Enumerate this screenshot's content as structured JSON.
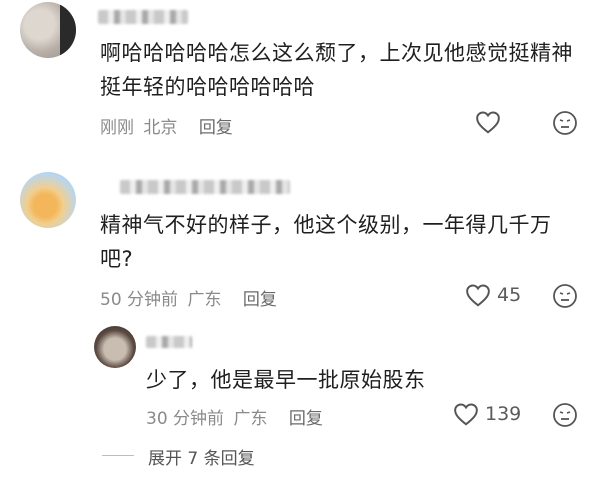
{
  "comments": [
    {
      "text_line1": "啊哈哈哈哈哈怎么这么颓了，上次见他感觉挺精神",
      "text_line2": "挺年轻的哈哈哈哈哈哈",
      "time": "刚刚",
      "location": "北京",
      "reply_label": "回复",
      "likes": ""
    },
    {
      "text_line1": "精神气不好的样子，他这个级别，一年得几千万",
      "text_line2": "吧?",
      "time": "50 分钟前",
      "location": "广东",
      "reply_label": "回复",
      "likes": "45"
    }
  ],
  "reply": {
    "text": "少了，他是最早一批原始股东",
    "time": "30 分钟前",
    "location": "广东",
    "reply_label": "回复",
    "likes": "139"
  },
  "expand_label": "展开 7 条回复",
  "icons": {
    "like": "heart-outline-icon",
    "dislike": "meh-face-icon"
  }
}
